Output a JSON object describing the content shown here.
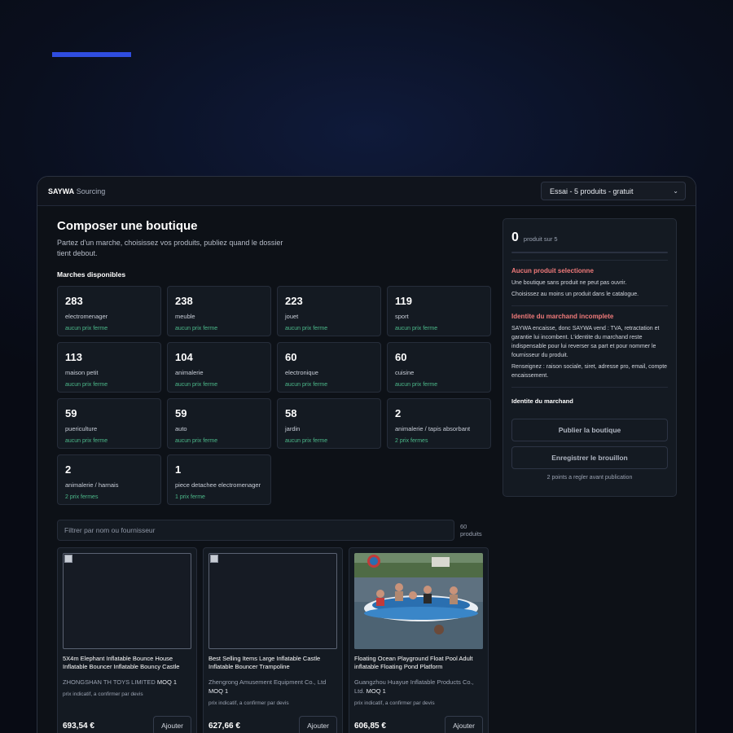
{
  "header": {
    "brand_bold": "SAYWA",
    "brand_rest": "Sourcing",
    "plan_select": "Essai - 5 produits - gratuit"
  },
  "main": {
    "title": "Composer une boutique",
    "subtitle": "Partez d'un marche, choisissez vos produits, publiez quand le dossier tient debout.",
    "markets_label": "Marches disponibles",
    "markets": [
      {
        "count": "283",
        "name": "electromenager",
        "status": "aucun prix ferme"
      },
      {
        "count": "238",
        "name": "meuble",
        "status": "aucun prix ferme"
      },
      {
        "count": "223",
        "name": "jouet",
        "status": "aucun prix ferme"
      },
      {
        "count": "119",
        "name": "sport",
        "status": "aucun prix ferme"
      },
      {
        "count": "113",
        "name": "maison petit",
        "status": "aucun prix ferme"
      },
      {
        "count": "104",
        "name": "animalerie",
        "status": "aucun prix ferme"
      },
      {
        "count": "60",
        "name": "electronique",
        "status": "aucun prix ferme"
      },
      {
        "count": "60",
        "name": "cuisine",
        "status": "aucun prix ferme"
      },
      {
        "count": "59",
        "name": "puericulture",
        "status": "aucun prix ferme"
      },
      {
        "count": "59",
        "name": "auto",
        "status": "aucun prix ferme"
      },
      {
        "count": "58",
        "name": "jardin",
        "status": "aucun prix ferme"
      },
      {
        "count": "2",
        "name": "animalerie / tapis absorbant",
        "status": "2 prix fermes"
      },
      {
        "count": "2",
        "name": "animalerie / harnais",
        "status": "2 prix fermes"
      },
      {
        "count": "1",
        "name": "piece detachee electromenager",
        "status": "1 prix ferme"
      }
    ],
    "filter_placeholder": "Filtrer par nom ou fournisseur",
    "product_count": "60 produits",
    "products": [
      {
        "name": "5X4m Elephant Inflatable Bounce House Inflatable Bouncer Inflatable Bouncy Castle",
        "supplier": "ZHONGSHAN TH TOYS LIMITED",
        "moq": "MOQ 1",
        "note": "prix indicatif, a confirmer par devis",
        "price": "693,54 €",
        "add": "Ajouter"
      },
      {
        "name": "Best Selling Items Large Inflatable Castle Inflatable Bouncer Trampoline",
        "supplier": "Zhengrong Amusement Equipment Co., Ltd",
        "moq": "MOQ 1",
        "note": "prix indicatif, a confirmer par devis",
        "price": "627,66 €",
        "add": "Ajouter"
      },
      {
        "name": "Floating Ocean Playground Float Pool Adult inflatable Floating Pond Platform",
        "supplier": "Guangzhou Huayue Inflatable Products Co., Ltd.",
        "moq": "MOQ 1",
        "note": "prix indicatif, a confirmer par devis",
        "price": "606,85 €",
        "add": "Ajouter"
      }
    ]
  },
  "sidebar": {
    "selected_count": "0",
    "selected_label": "produit sur 5",
    "progress_fraction": 0,
    "warn1_title": "Aucun produit selectionne",
    "warn1_text": "Une boutique sans produit ne peut pas ouvrir.",
    "warn1_text2": "Choisissez au moins un produit dans le catalogue.",
    "warn2_title": "Identite du marchand incomplete",
    "warn2_text": "SAYWA encaisse, donc SAYWA vend : TVA, retractation et garantie lui incombent. L'identite du marchand reste indispensable pour lui reverser sa part et pour nommer le fournisseur du produit.",
    "warn2_text2": "Renseignez : raison sociale, siret, adresse pro, email, compte encaissement.",
    "merchant_title": "Identite du marchand",
    "publish_button": "Publier la boutique",
    "draft_button": "Enregistrer le brouillon",
    "footnote": "2 points a regler avant publication"
  }
}
